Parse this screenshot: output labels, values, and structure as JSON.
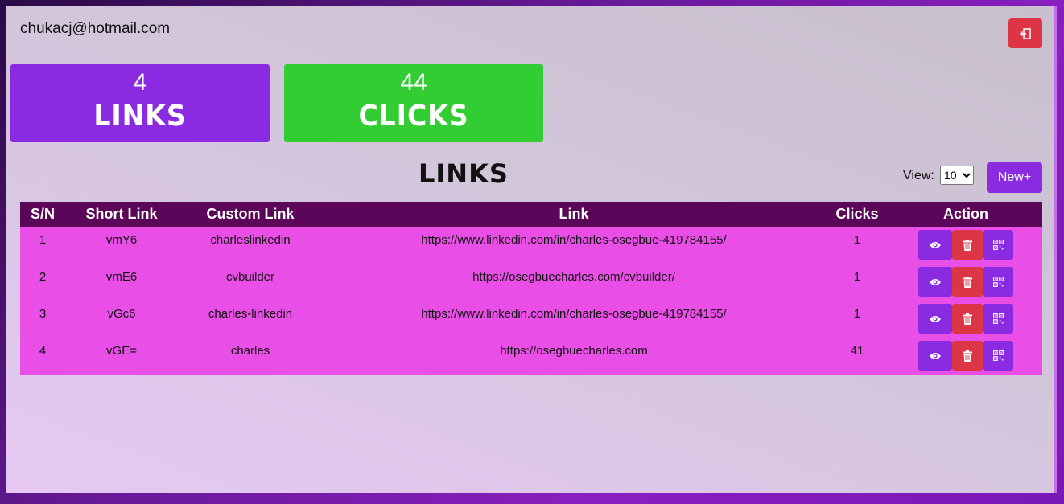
{
  "header": {
    "email": "chukacj@hotmail.com",
    "logout_icon": "logout-icon"
  },
  "stats": [
    {
      "value": "4",
      "label": "LINKS",
      "color": "#8a2be2"
    },
    {
      "value": "44",
      "label": "CLICKS",
      "color": "#32cd32"
    }
  ],
  "links_section": {
    "title": "LINKS",
    "view_label": "View:",
    "view_value": "10",
    "new_button": "New+"
  },
  "table": {
    "columns": [
      "S/N",
      "Short Link",
      "Custom Link",
      "Link",
      "Clicks",
      "Action"
    ],
    "rows": [
      {
        "sn": "1",
        "short": "vmY6",
        "custom": "charleslinkedin",
        "link": "https://www.linkedin.com/in/charles-osegbue-419784155/",
        "clicks": "1"
      },
      {
        "sn": "2",
        "short": "vmE6",
        "custom": "cvbuilder",
        "link": "https://osegbuecharles.com/cvbuilder/",
        "clicks": "1"
      },
      {
        "sn": "3",
        "short": "vGc6",
        "custom": "charles-linkedin",
        "link": "https://www.linkedin.com/in/charles-osegbue-419784155/",
        "clicks": "1"
      },
      {
        "sn": "4",
        "short": "vGE=",
        "custom": "charles",
        "link": "https://osegbuecharles.com",
        "clicks": "41"
      }
    ],
    "action_icons": [
      "eye-icon",
      "trash-icon",
      "qr-code-icon"
    ]
  },
  "colors": {
    "accent": "#8a2be2",
    "danger": "#dc3545",
    "success": "#32cd32",
    "table_header": "#5c0659",
    "table_row": "#e94ee6"
  }
}
